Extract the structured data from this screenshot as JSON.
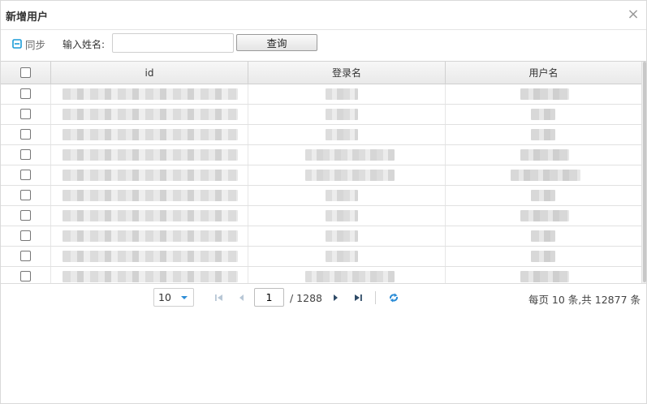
{
  "dialog": {
    "title": "新增用户",
    "close_symbol": "×"
  },
  "toolbar": {
    "sync_label": "同步",
    "search_label": "输入姓名:",
    "search_value": "",
    "query_label": "查询"
  },
  "grid": {
    "columns": [
      "id",
      "登录名",
      "用户名"
    ],
    "row_count": 10
  },
  "pager": {
    "page_size": "10",
    "current_page": "1",
    "total_pages": "/ 1288",
    "info": "每页 10 条,共 12877 条"
  },
  "colors": {
    "accent": "#2b8cd6",
    "sync_icon": "#1a9cd8"
  },
  "icons": {
    "sync": "save-icon",
    "close": "close-icon",
    "first": "first-page-icon",
    "prev": "prev-page-icon",
    "next": "next-page-icon",
    "last": "last-page-icon",
    "refresh": "refresh-icon"
  }
}
